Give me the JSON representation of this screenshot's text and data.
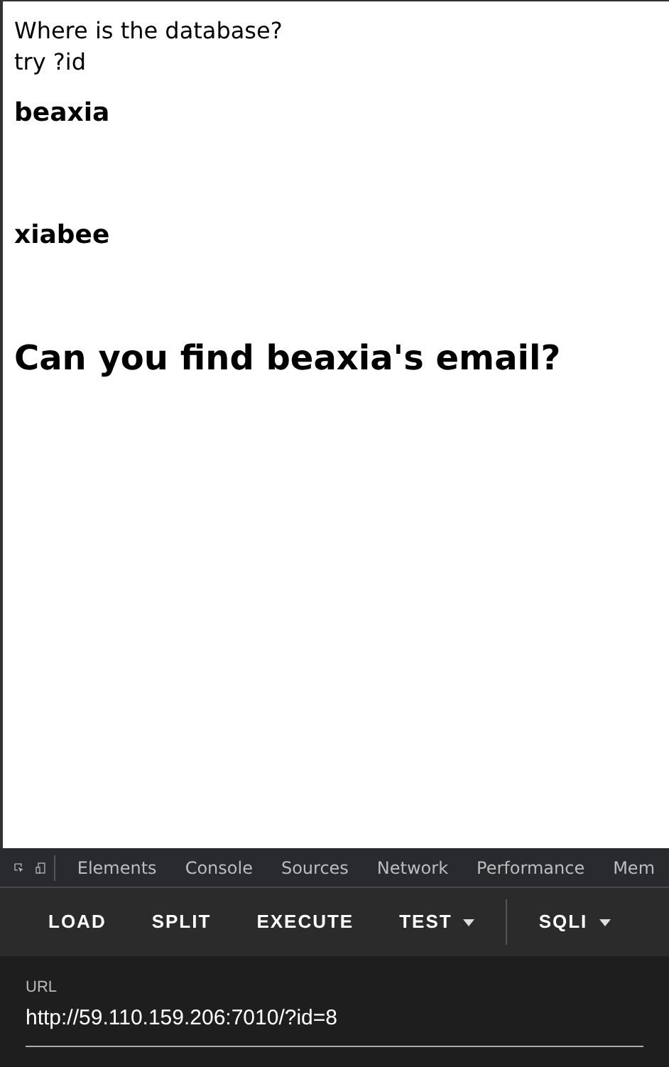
{
  "page": {
    "lines": [
      "Where is the database?",
      "try ?id"
    ],
    "names": [
      "beaxia",
      "xiabee"
    ],
    "question": "Can you find beaxia's email?"
  },
  "devtools": {
    "tabs": [
      "Elements",
      "Console",
      "Sources",
      "Network",
      "Performance",
      "Mem"
    ],
    "toolbar": [
      {
        "label": "LOAD",
        "dropdown": false
      },
      {
        "label": "SPLIT",
        "dropdown": false
      },
      {
        "label": "EXECUTE",
        "dropdown": false
      },
      {
        "label": "TEST",
        "dropdown": true
      },
      {
        "label": "SQLI",
        "dropdown": true
      }
    ],
    "url_label": "URL",
    "url_value": "http://59.110.159.206:7010/?id=8"
  }
}
